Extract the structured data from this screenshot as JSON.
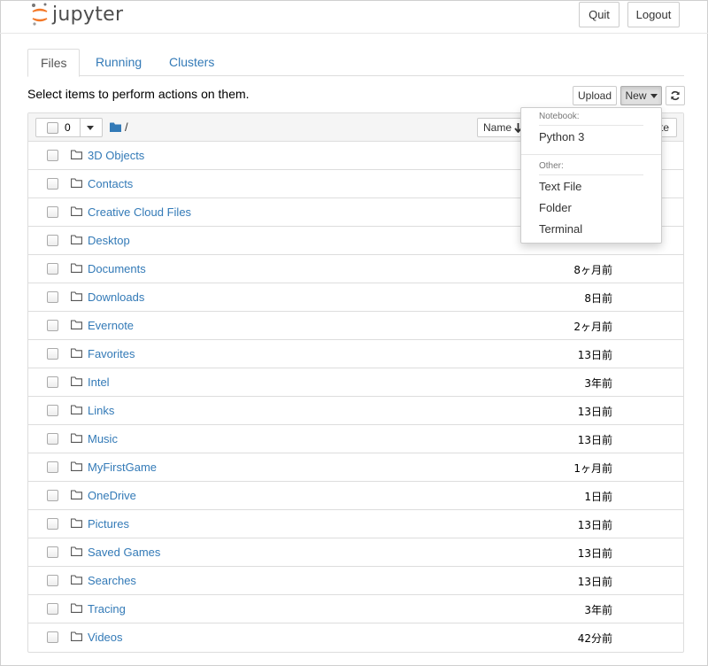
{
  "app": {
    "logo_text": "jupyter"
  },
  "header": {
    "quit_label": "Quit",
    "logout_label": "Logout"
  },
  "tabs": [
    {
      "label": "Files",
      "active": true
    },
    {
      "label": "Running",
      "active": false
    },
    {
      "label": "Clusters",
      "active": false
    }
  ],
  "hint": "Select items to perform actions on them.",
  "toolbar": {
    "upload_label": "Upload",
    "new_label": "New"
  },
  "list_header": {
    "selected_count": "0",
    "path": "/",
    "sort_label": "Name",
    "sort_direction": "down",
    "modified_label_partial": "te"
  },
  "files": [
    {
      "name": "3D Objects",
      "modified": ""
    },
    {
      "name": "Contacts",
      "modified": ""
    },
    {
      "name": "Creative Cloud Files",
      "modified": ""
    },
    {
      "name": "Desktop",
      "modified": ""
    },
    {
      "name": "Documents",
      "modified": "8ヶ月前"
    },
    {
      "name": "Downloads",
      "modified": "8日前"
    },
    {
      "name": "Evernote",
      "modified": "2ヶ月前"
    },
    {
      "name": "Favorites",
      "modified": "13日前"
    },
    {
      "name": "Intel",
      "modified": "3年前"
    },
    {
      "name": "Links",
      "modified": "13日前"
    },
    {
      "name": "Music",
      "modified": "13日前"
    },
    {
      "name": "MyFirstGame",
      "modified": "1ヶ月前"
    },
    {
      "name": "OneDrive",
      "modified": "1日前"
    },
    {
      "name": "Pictures",
      "modified": "13日前"
    },
    {
      "name": "Saved Games",
      "modified": "13日前"
    },
    {
      "name": "Searches",
      "modified": "13日前"
    },
    {
      "name": "Tracing",
      "modified": "3年前"
    },
    {
      "name": "Videos",
      "modified": "42分前"
    }
  ],
  "new_menu": {
    "notebook_header": "Notebook:",
    "notebook_items": [
      "Python 3"
    ],
    "other_header": "Other:",
    "other_items": [
      "Text File",
      "Folder",
      "Terminal"
    ]
  },
  "colors": {
    "link": "#337ab7",
    "logo_orange": "#f37726",
    "new_button_active": "#e0e0e0"
  }
}
